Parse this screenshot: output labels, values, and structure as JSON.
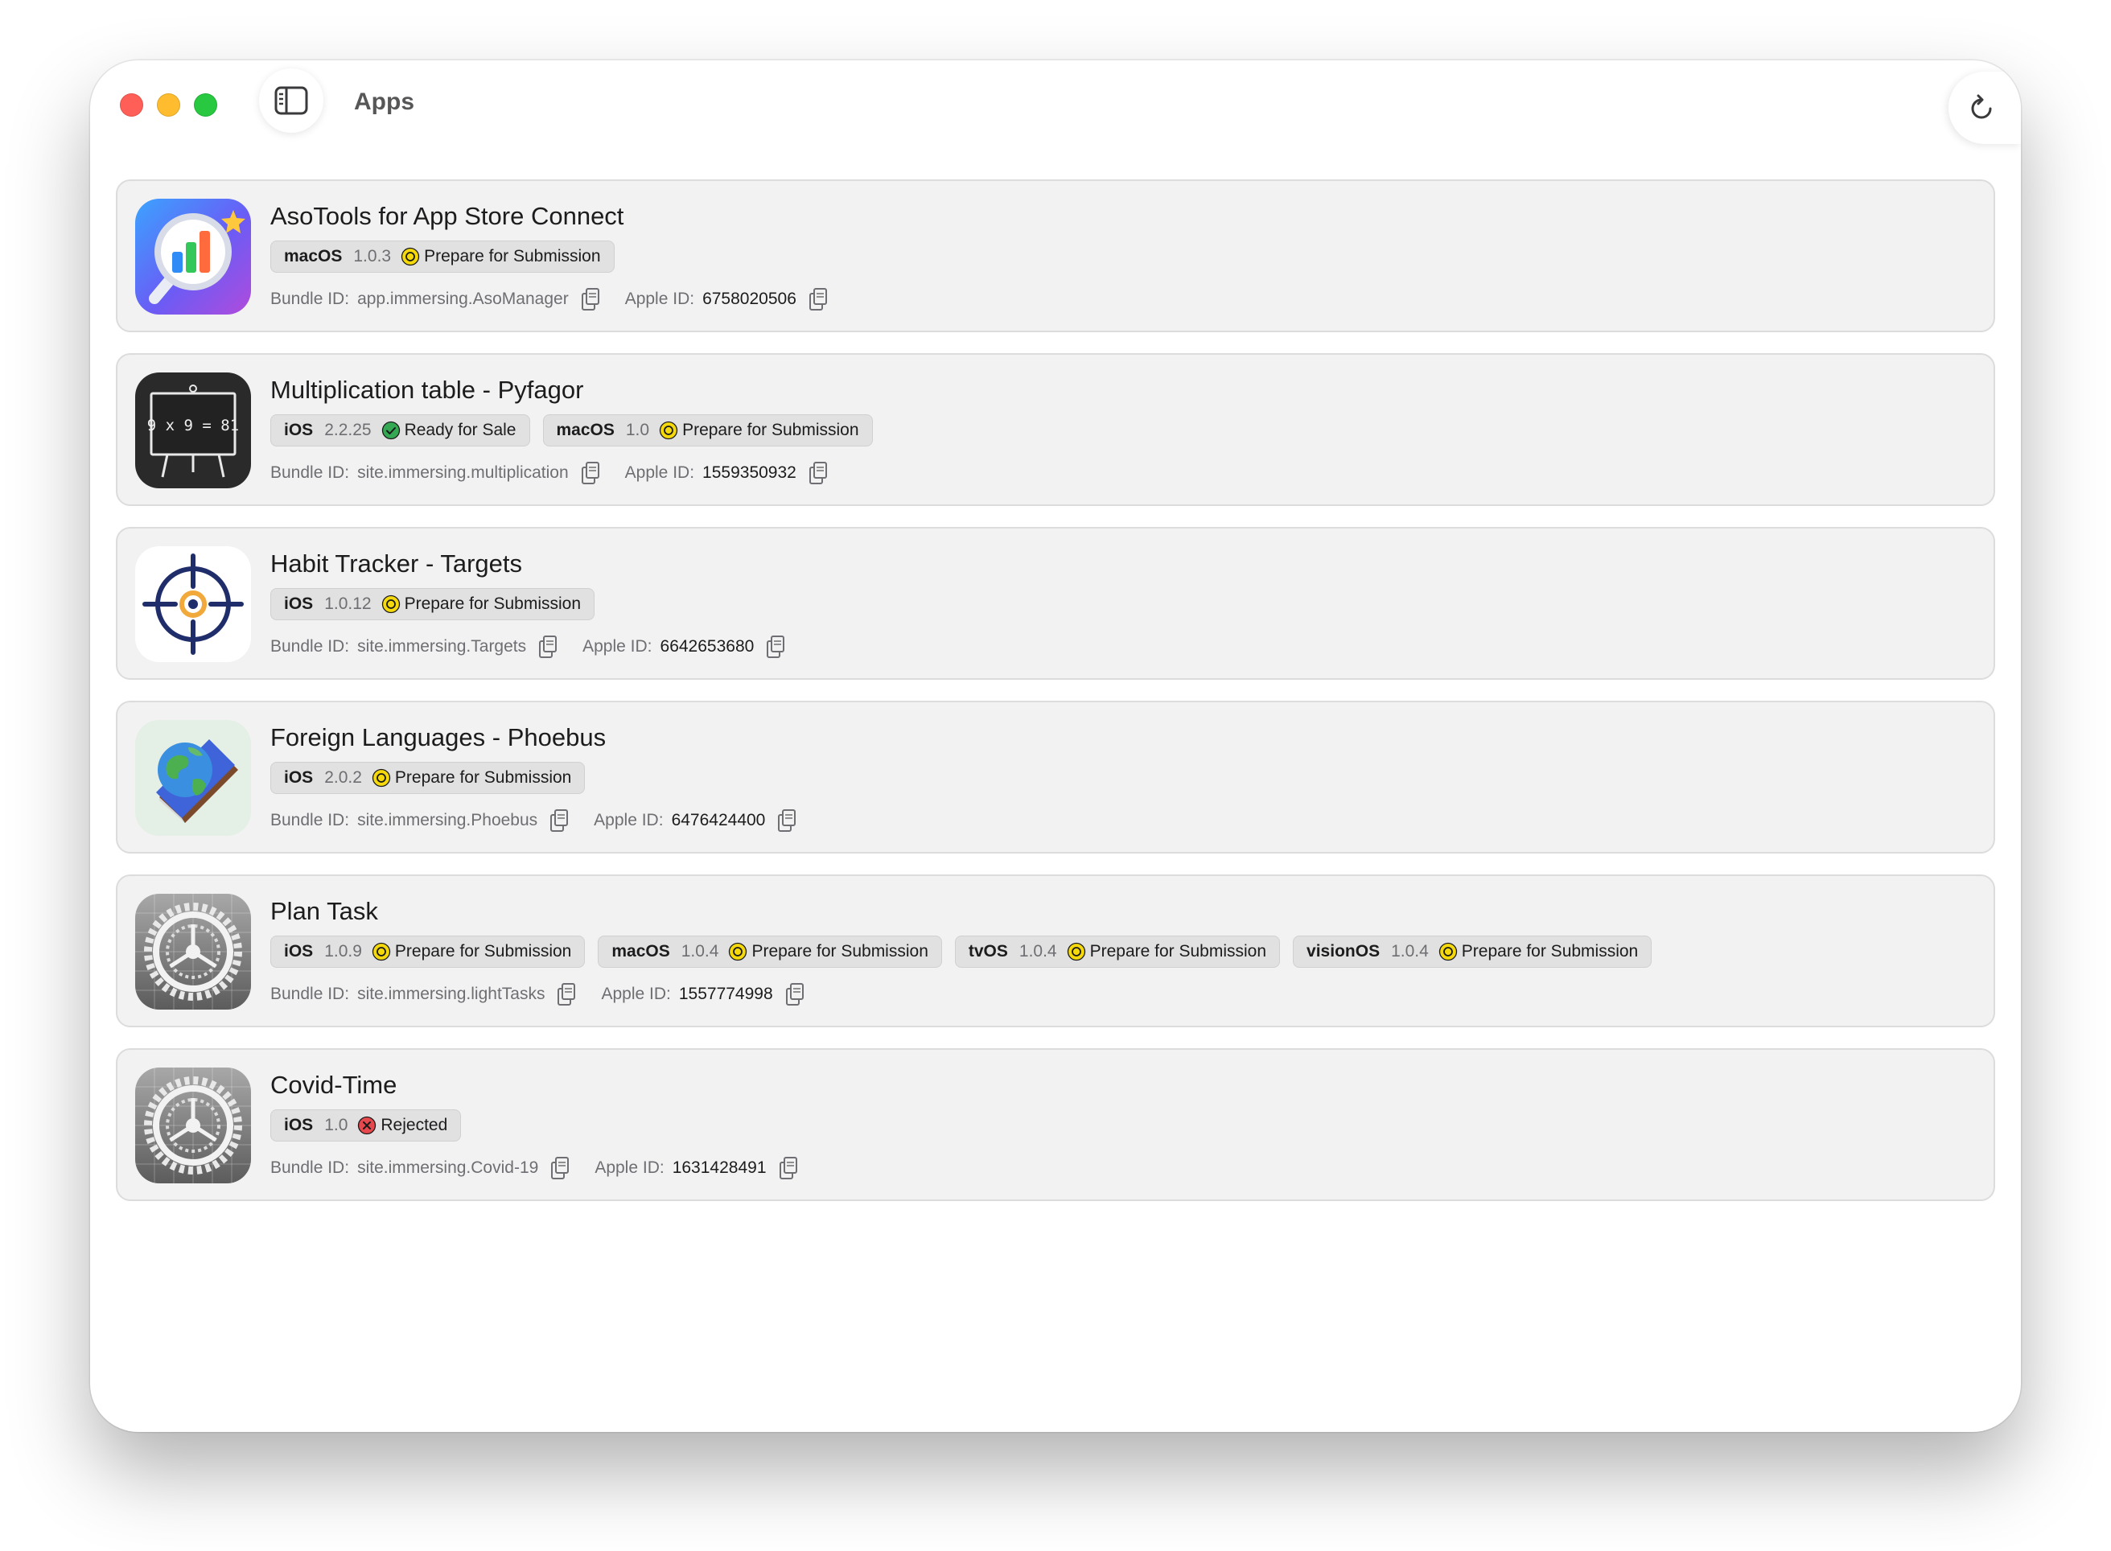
{
  "window": {
    "title": "Apps"
  },
  "colors": {
    "prepare": "#f5d90a",
    "ready": "#34a853",
    "rejected": "#e5484d"
  },
  "labels": {
    "bundle_id": "Bundle ID:",
    "apple_id": "Apple ID:"
  },
  "apps": [
    {
      "name": "AsoTools for App Store Connect",
      "icon": "asotools-icon",
      "platforms": [
        {
          "name": "macOS",
          "version": "1.0.3",
          "status": "Prepare for Submission",
          "state": "prepare"
        }
      ],
      "bundle_id": "app.immersing.AsoManager",
      "apple_id": "6758020506"
    },
    {
      "name": "Multiplication table - Pyfagor",
      "icon": "chalkboard-icon",
      "icon_text": "9 x 9 = 81",
      "platforms": [
        {
          "name": "iOS",
          "version": "2.2.25",
          "status": "Ready for Sale",
          "state": "ready"
        },
        {
          "name": "macOS",
          "version": "1.0",
          "status": "Prepare for Submission",
          "state": "prepare"
        }
      ],
      "bundle_id": "site.immersing.multiplication",
      "apple_id": "1559350932"
    },
    {
      "name": "Habit Tracker - Targets",
      "icon": "target-icon",
      "platforms": [
        {
          "name": "iOS",
          "version": "1.0.12",
          "status": "Prepare for Submission",
          "state": "prepare"
        }
      ],
      "bundle_id": "site.immersing.Targets",
      "apple_id": "6642653680"
    },
    {
      "name": "Foreign Languages - Phoebus",
      "icon": "globe-book-icon",
      "platforms": [
        {
          "name": "iOS",
          "version": "2.0.2",
          "status": "Prepare for Submission",
          "state": "prepare"
        }
      ],
      "bundle_id": "site.immersing.Phoebus",
      "apple_id": "6476424400"
    },
    {
      "name": "Plan Task",
      "icon": "gear-placeholder-icon",
      "platforms": [
        {
          "name": "iOS",
          "version": "1.0.9",
          "status": "Prepare for Submission",
          "state": "prepare"
        },
        {
          "name": "macOS",
          "version": "1.0.4",
          "status": "Prepare for Submission",
          "state": "prepare"
        },
        {
          "name": "tvOS",
          "version": "1.0.4",
          "status": "Prepare for Submission",
          "state": "prepare"
        },
        {
          "name": "visionOS",
          "version": "1.0.4",
          "status": "Prepare for Submission",
          "state": "prepare"
        }
      ],
      "bundle_id": "site.immersing.lightTasks",
      "apple_id": "1557774998"
    },
    {
      "name": "Covid-Time",
      "icon": "gear-placeholder-icon",
      "platforms": [
        {
          "name": "iOS",
          "version": "1.0",
          "status": "Rejected",
          "state": "rejected"
        }
      ],
      "bundle_id": "site.immersing.Covid-19",
      "apple_id": "1631428491"
    }
  ]
}
